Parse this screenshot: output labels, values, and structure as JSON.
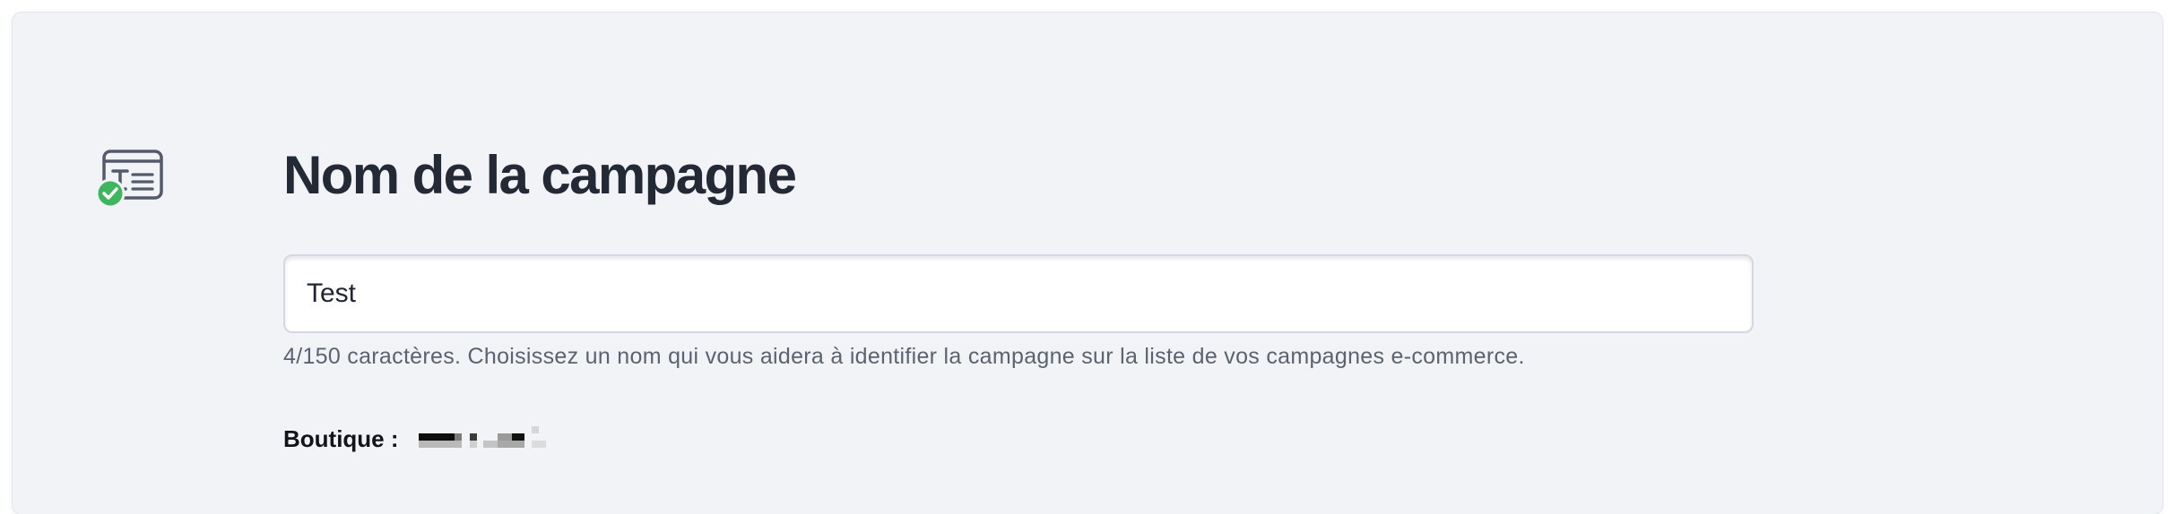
{
  "campaign_name": {
    "title": "Nom de la campagne",
    "input_value": "Test",
    "char_count": "4/150 caractères.",
    "help_text": " Choisissez un nom qui vous aidera à identifier la campagne sur la liste de vos campagnes e-commerce."
  },
  "shop": {
    "label": "Boutique :",
    "value_state": "redacted"
  },
  "icons": {
    "section": "text-card-icon",
    "status": "check-badge-icon"
  },
  "colors": {
    "card_background": "#f2f3f7",
    "title": "#232a35",
    "helper_text": "#5b6270",
    "success": "#3fb65e"
  }
}
